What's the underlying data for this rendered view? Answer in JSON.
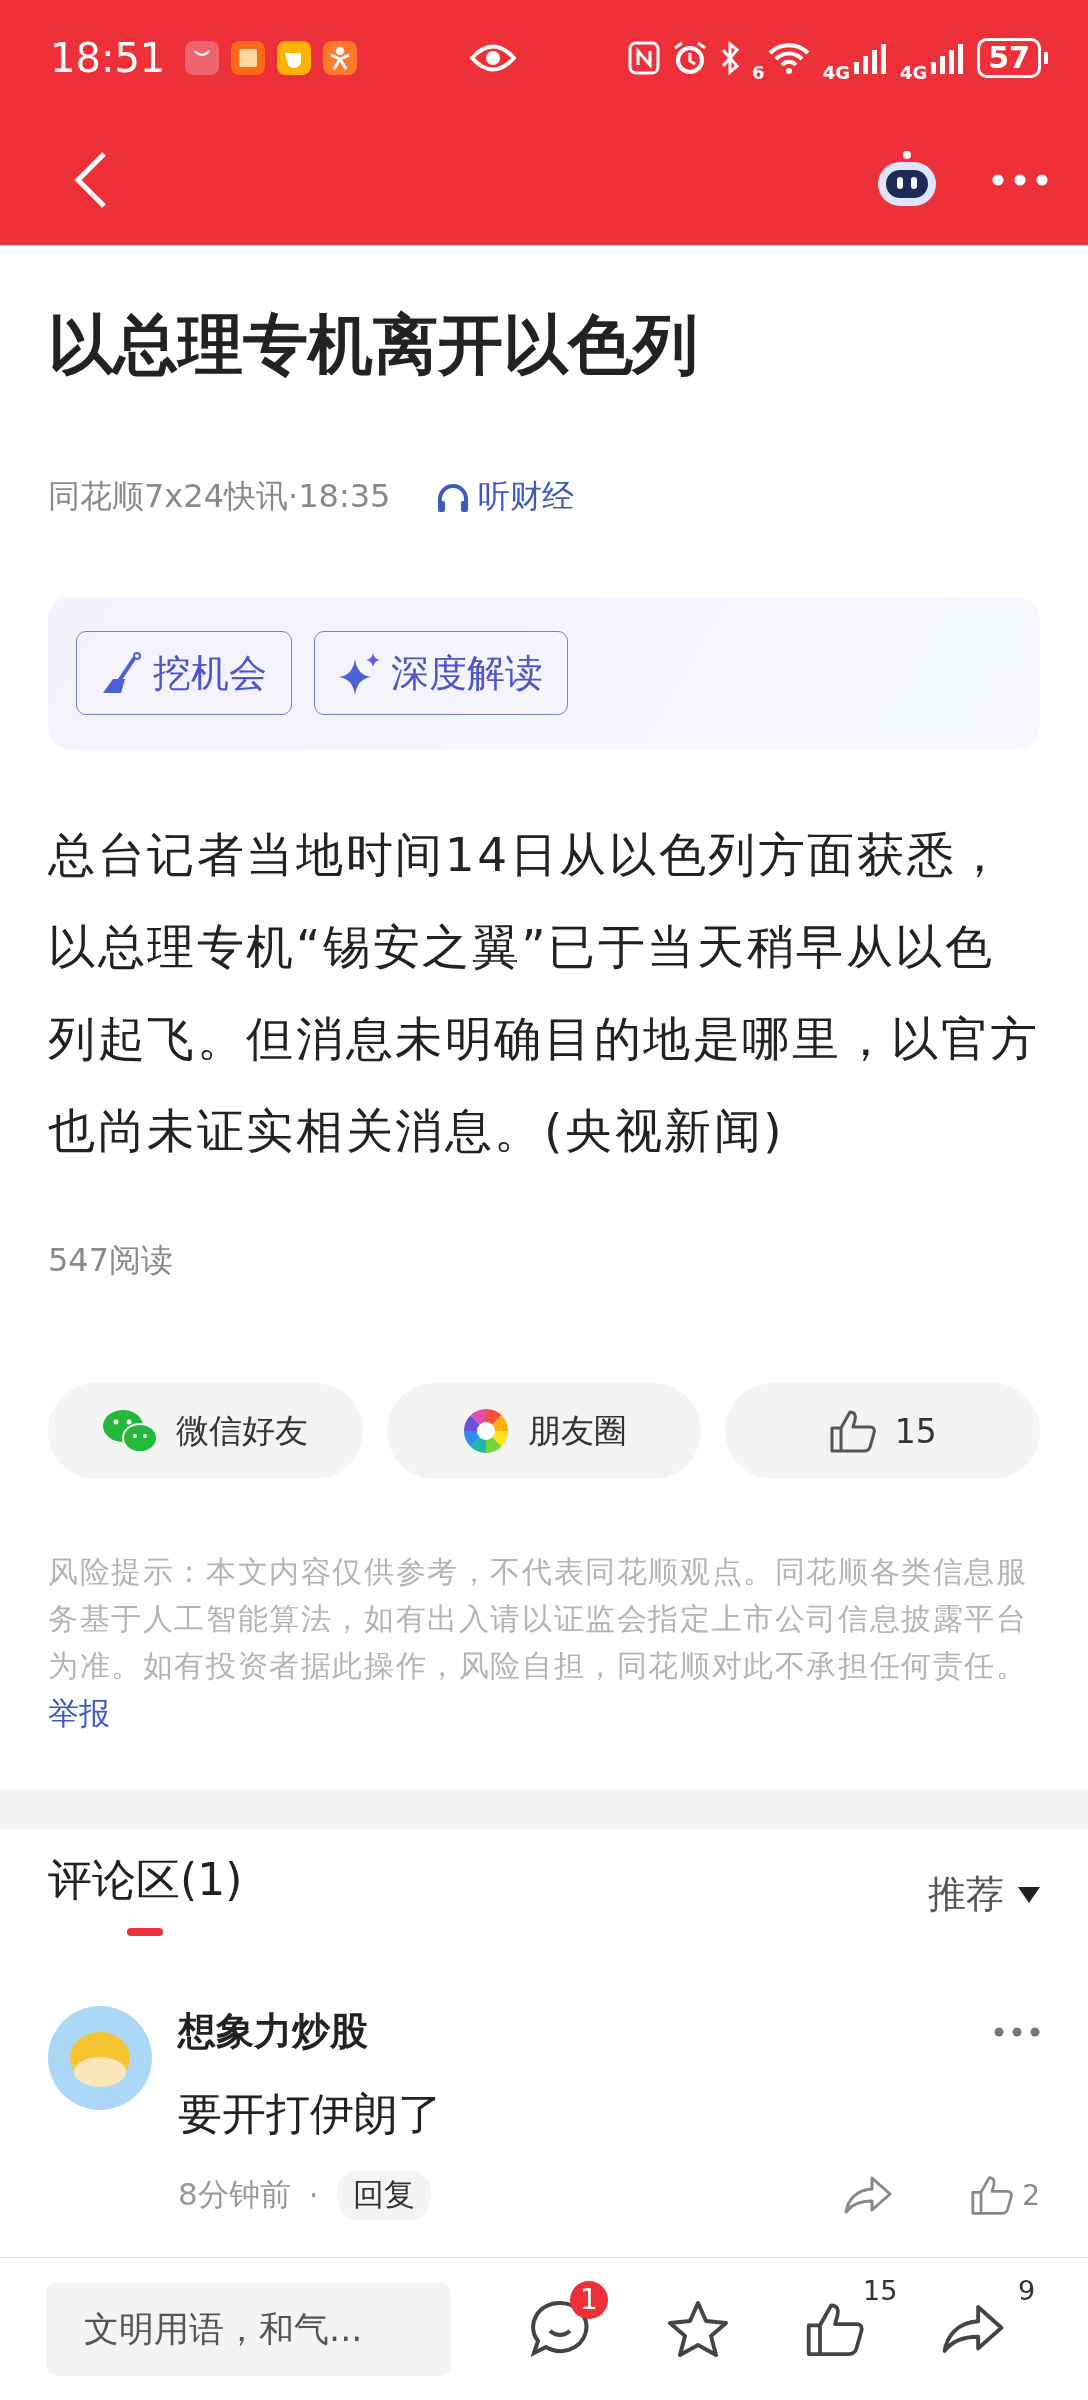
{
  "status_bar": {
    "time": "18:51",
    "wifi_label": "6",
    "network_labels": [
      "4G",
      "4G"
    ],
    "battery": "57"
  },
  "article": {
    "title": "以总理专机离开以色列",
    "source": "同花顺7x24快讯·18:35",
    "listen": "听财经",
    "tools": [
      {
        "kind": "dig",
        "label": "挖机会"
      },
      {
        "kind": "ai",
        "label": "深度解读"
      }
    ],
    "body": "总台记者当地时间14日从以色列方面获悉，以总理专机“锡安之翼”已于当天稍早从以色列起飞。但消息未明确目的地是哪里，以官方也尚未证实相关消息。(央视新闻)",
    "reads": "547阅读"
  },
  "share": [
    {
      "kind": "wechat",
      "label": "微信好友"
    },
    {
      "kind": "moments",
      "label": "朋友圈"
    },
    {
      "kind": "like",
      "label": "15"
    }
  ],
  "disclaimer": "风险提示：本文内容仅供参考，不代表同花顺观点。同花顺各类信息服务基于人工智能算法，如有出入请以证监会指定上市公司信息披露平台为准。如有投资者据此操作，风险自担，同花顺对此不承担任何责任。",
  "report": "举报",
  "comments": {
    "title": "评论区(1)",
    "sort": "推荐",
    "items": [
      {
        "user": "想象力炒股",
        "text": "要开打伊朗了",
        "time": "8分钟前",
        "separator": "·",
        "reply": "回复",
        "likes": "2"
      }
    ]
  },
  "bottom_bar": {
    "placeholder": "文明用语，和气...",
    "comment_badge": "1",
    "like_count": "15",
    "share_count": "9"
  }
}
